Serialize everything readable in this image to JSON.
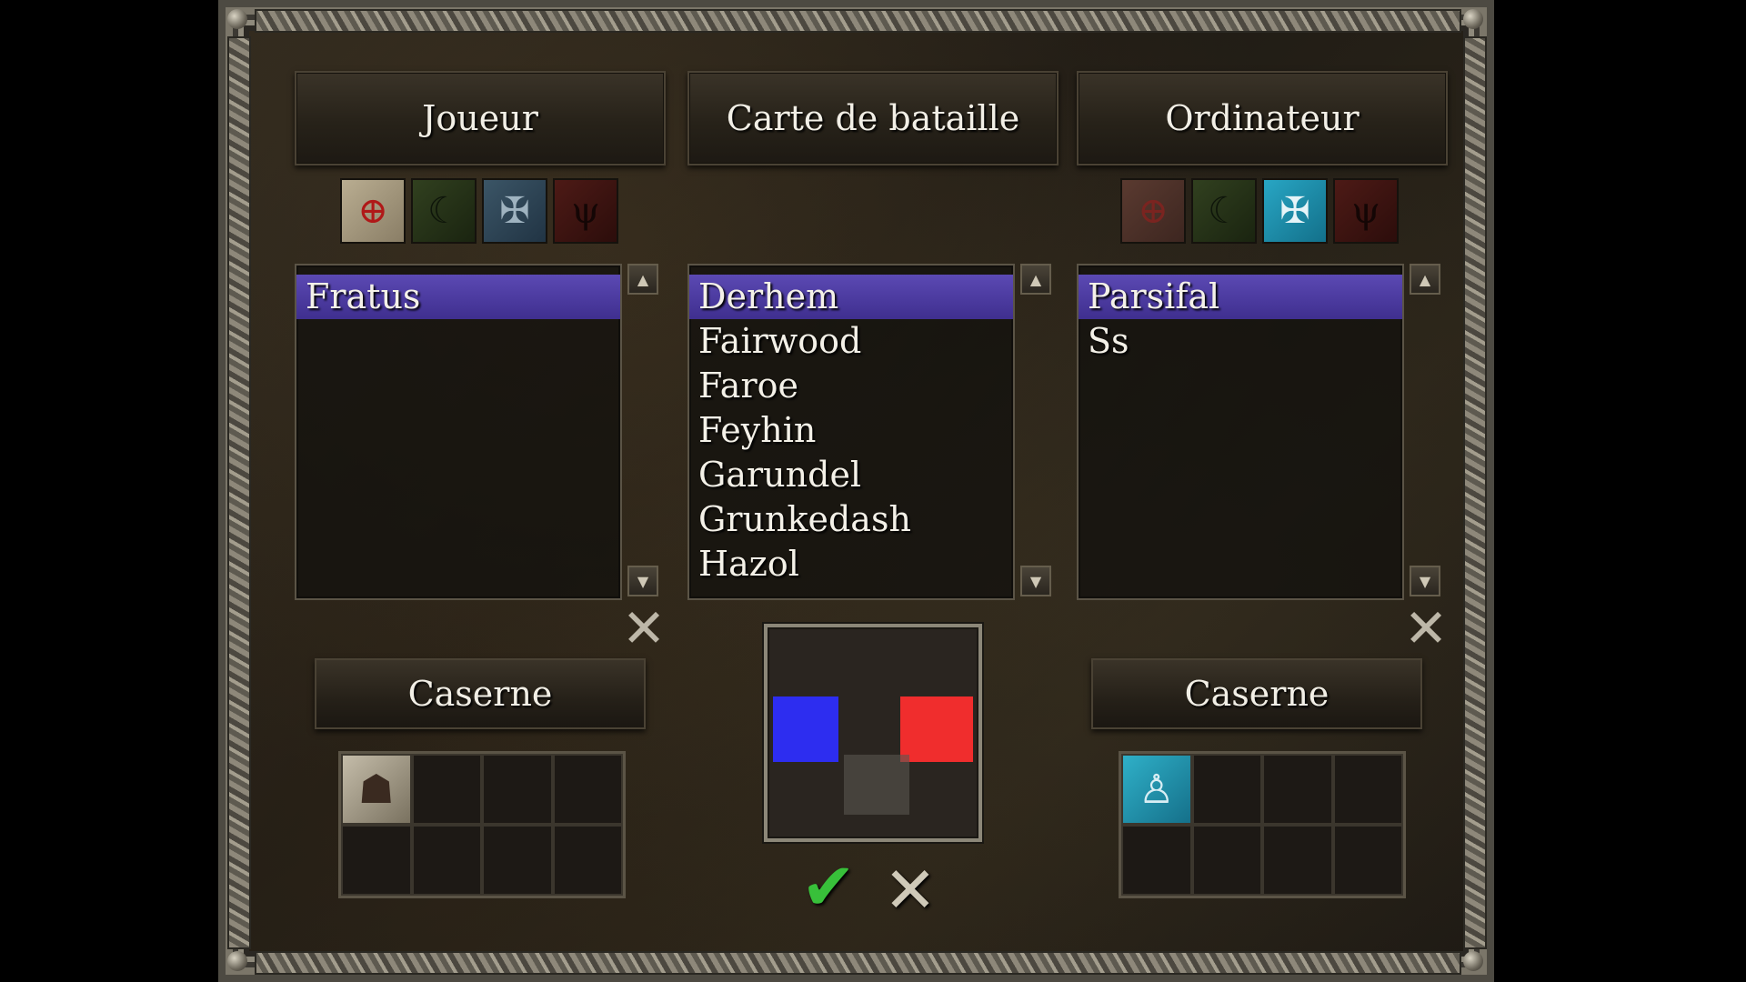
{
  "header": {
    "player_label": "Joueur",
    "map_label": "Carte de bataille",
    "computer_label": "Ordinateur"
  },
  "factions": {
    "player": [
      "cross-circle-icon",
      "crescent-icon",
      "eagle-icon",
      "demon-icon"
    ],
    "computer": [
      "cross-circle-icon",
      "crescent-icon",
      "eagle-icon",
      "demon-icon"
    ],
    "computer_selected": "eagle-icon"
  },
  "player_list": [
    "Fratus"
  ],
  "map_list": [
    "Derhem",
    "Fairwood",
    "Faroe",
    "Feyhin",
    "Garundel",
    "Grunkedash",
    "Hazol"
  ],
  "computer_list": [
    "Parsifal",
    "Ss"
  ],
  "barracks": {
    "player_label": "Caserne",
    "computer_label": "Caserne"
  },
  "minimap": {
    "player_color": "#2d2df0",
    "computer_color": "#f02d2d"
  },
  "actions": {
    "confirm_icon": "checkmark-icon",
    "cancel_icon": "close-icon"
  },
  "colors": {
    "selection": "#4b3ba8",
    "text": "#f4f1e8"
  }
}
